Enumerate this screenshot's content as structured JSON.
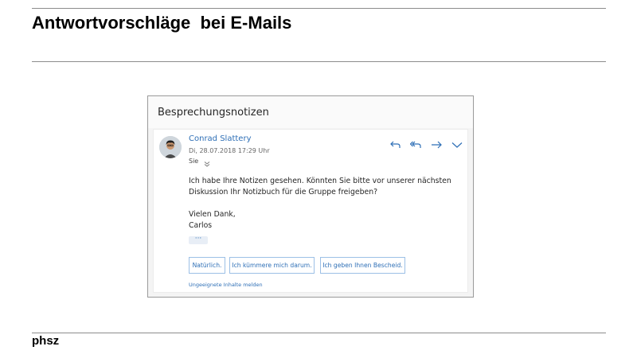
{
  "slide": {
    "title": "Antwortvorschläge  bei E-Mails",
    "footer": "phsz"
  },
  "email": {
    "subject": "Besprechungsnotizen",
    "sender": "Conrad Slattery",
    "date": "Di, 28.07.2018 17:29 Uhr",
    "to": "Sie",
    "body_line1": "Ich habe Ihre Notizen gesehen. Könnten Sie bitte vor unserer nächsten",
    "body_line2": "Diskussion Ihr Notizbuch für die Gruppe freigeben?",
    "closing_line1": "Vielen Dank,",
    "closing_line2": "Carlos",
    "more_label": "···",
    "suggested_replies": [
      "Natürlich.",
      "Ich kümmere mich darum.",
      "Ich geben Ihnen Bescheid."
    ],
    "report_link": "Ungeeignete Inhalte melden"
  },
  "icons": {
    "reply": "reply-icon",
    "reply_all": "reply-all-icon",
    "forward": "forward-icon",
    "more": "chevron-down-icon",
    "accent_color": "#2e6fb6"
  }
}
